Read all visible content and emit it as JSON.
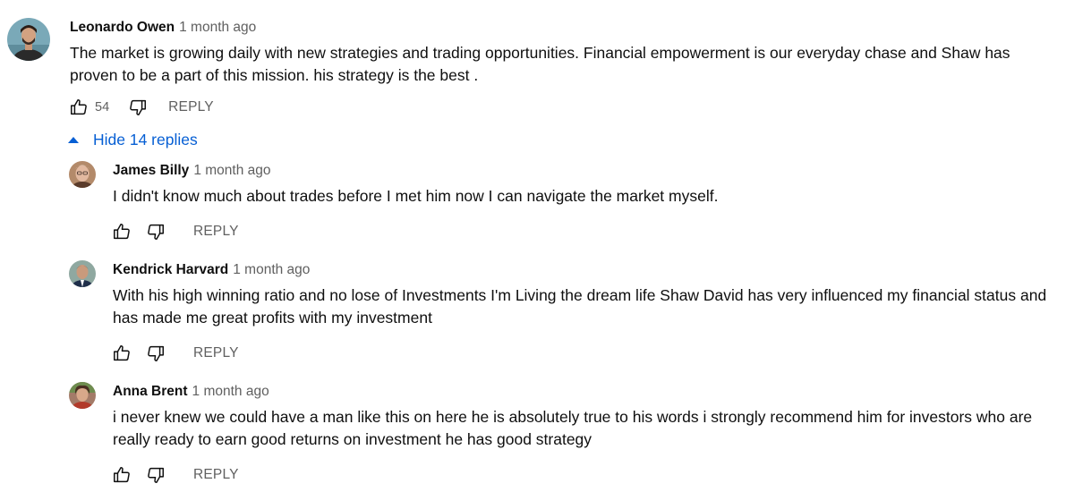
{
  "top_comment": {
    "author": "Leonardo Owen",
    "time": "1 month ago",
    "text": "The market is growing daily with new strategies and trading opportunities. Financial empowerment is our everyday chase and Shaw has proven to be a part of this mission. his strategy is the best .",
    "likes": "54",
    "reply_label": "REPLY",
    "avatar_icon": "person-avatar"
  },
  "replies_toggle": {
    "label": "Hide 14 replies",
    "icon": "caret-up-icon",
    "color": "#065fd4"
  },
  "replies": [
    {
      "author": "James Billy",
      "time": "1 month ago",
      "text": "I didn't know much about trades before I met him now I can navigate the market myself.",
      "reply_label": "REPLY"
    },
    {
      "author": "Kendrick Harvard",
      "time": "1 month ago",
      "text": "With his high winning ratio and no lose of Investments I'm Living the dream life Shaw David has very influenced my financial status and has made me great profits with my investment",
      "reply_label": "REPLY"
    },
    {
      "author": "Anna Brent",
      "time": "1 month ago",
      "text": "i never knew we could have a man like this on here he is absolutely true to his words i strongly recommend him for investors who are really ready to earn good returns on investment he has good strategy",
      "reply_label": "REPLY"
    }
  ]
}
